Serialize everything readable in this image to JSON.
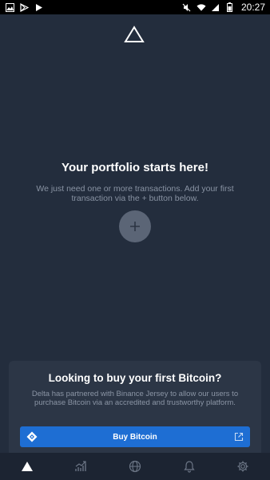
{
  "status_bar": {
    "time": "20:27",
    "left_icons": [
      "image-icon",
      "play-store-icon",
      "play-icon"
    ],
    "right_icons": [
      "mute-icon",
      "wifi-icon",
      "signal-icon",
      "battery-icon"
    ]
  },
  "empty_state": {
    "title": "Your portfolio starts here!",
    "description": "We just need one or more transactions. Add your first transaction via the + button below.",
    "add_button_icon": "plus-icon"
  },
  "buy_card": {
    "title": "Looking to buy your first Bitcoin?",
    "description": "Delta has partnered with Binance Jersey to allow our users to purchase Bitcoin via an accredited and trustworthy platform.",
    "button_label": "Buy Bitcoin",
    "button_color": "#1e6ed3"
  },
  "bottom_nav": {
    "items": [
      {
        "icon": "delta-icon",
        "active": true
      },
      {
        "icon": "chart-icon",
        "active": false
      },
      {
        "icon": "globe-icon",
        "active": false
      },
      {
        "icon": "bell-icon",
        "active": false
      },
      {
        "icon": "gear-icon",
        "active": false
      }
    ]
  },
  "colors": {
    "background": "#232d3d",
    "card": "#2c3646",
    "nav": "#1c2432",
    "accent": "#1e6ed3"
  }
}
